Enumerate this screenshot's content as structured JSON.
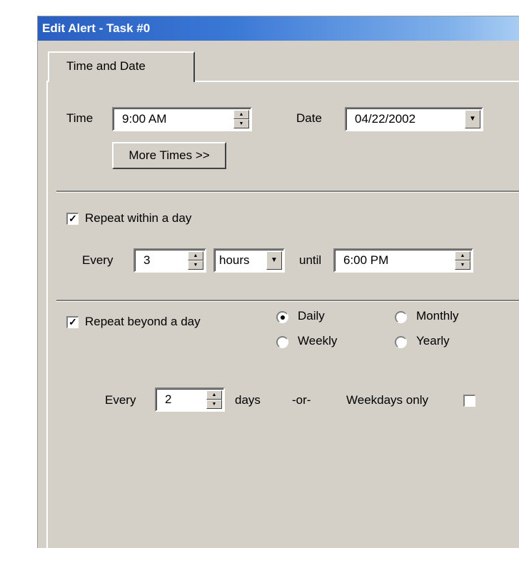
{
  "window": {
    "title": "Edit Alert - Task #0"
  },
  "tabs": [
    {
      "label": "Time and Date"
    }
  ],
  "time_section": {
    "time_label": "Time",
    "time_value": "9:00 AM",
    "date_label": "Date",
    "date_value": "04/22/2002",
    "more_times_label": "More Times >>"
  },
  "repeat_within_day": {
    "checkbox_label": "Repeat within a day",
    "checked": true,
    "every_label": "Every",
    "interval_value": "3",
    "unit_value": "hours",
    "until_label": "until",
    "until_value": "6:00 PM"
  },
  "repeat_beyond_day": {
    "checkbox_label": "Repeat beyond a day",
    "checked": true,
    "radio_options": [
      "Daily",
      "Monthly",
      "Weekly",
      "Yearly"
    ],
    "selected": "Daily",
    "every_label": "Every",
    "interval_value": "2",
    "unit_label": "days",
    "or_label": "-or-",
    "weekdays_only_label": "Weekdays only",
    "weekdays_only_checked": false
  },
  "icons": {
    "check": "✓",
    "spin_up": "▲",
    "spin_down": "▼",
    "dropdown": "▼"
  }
}
